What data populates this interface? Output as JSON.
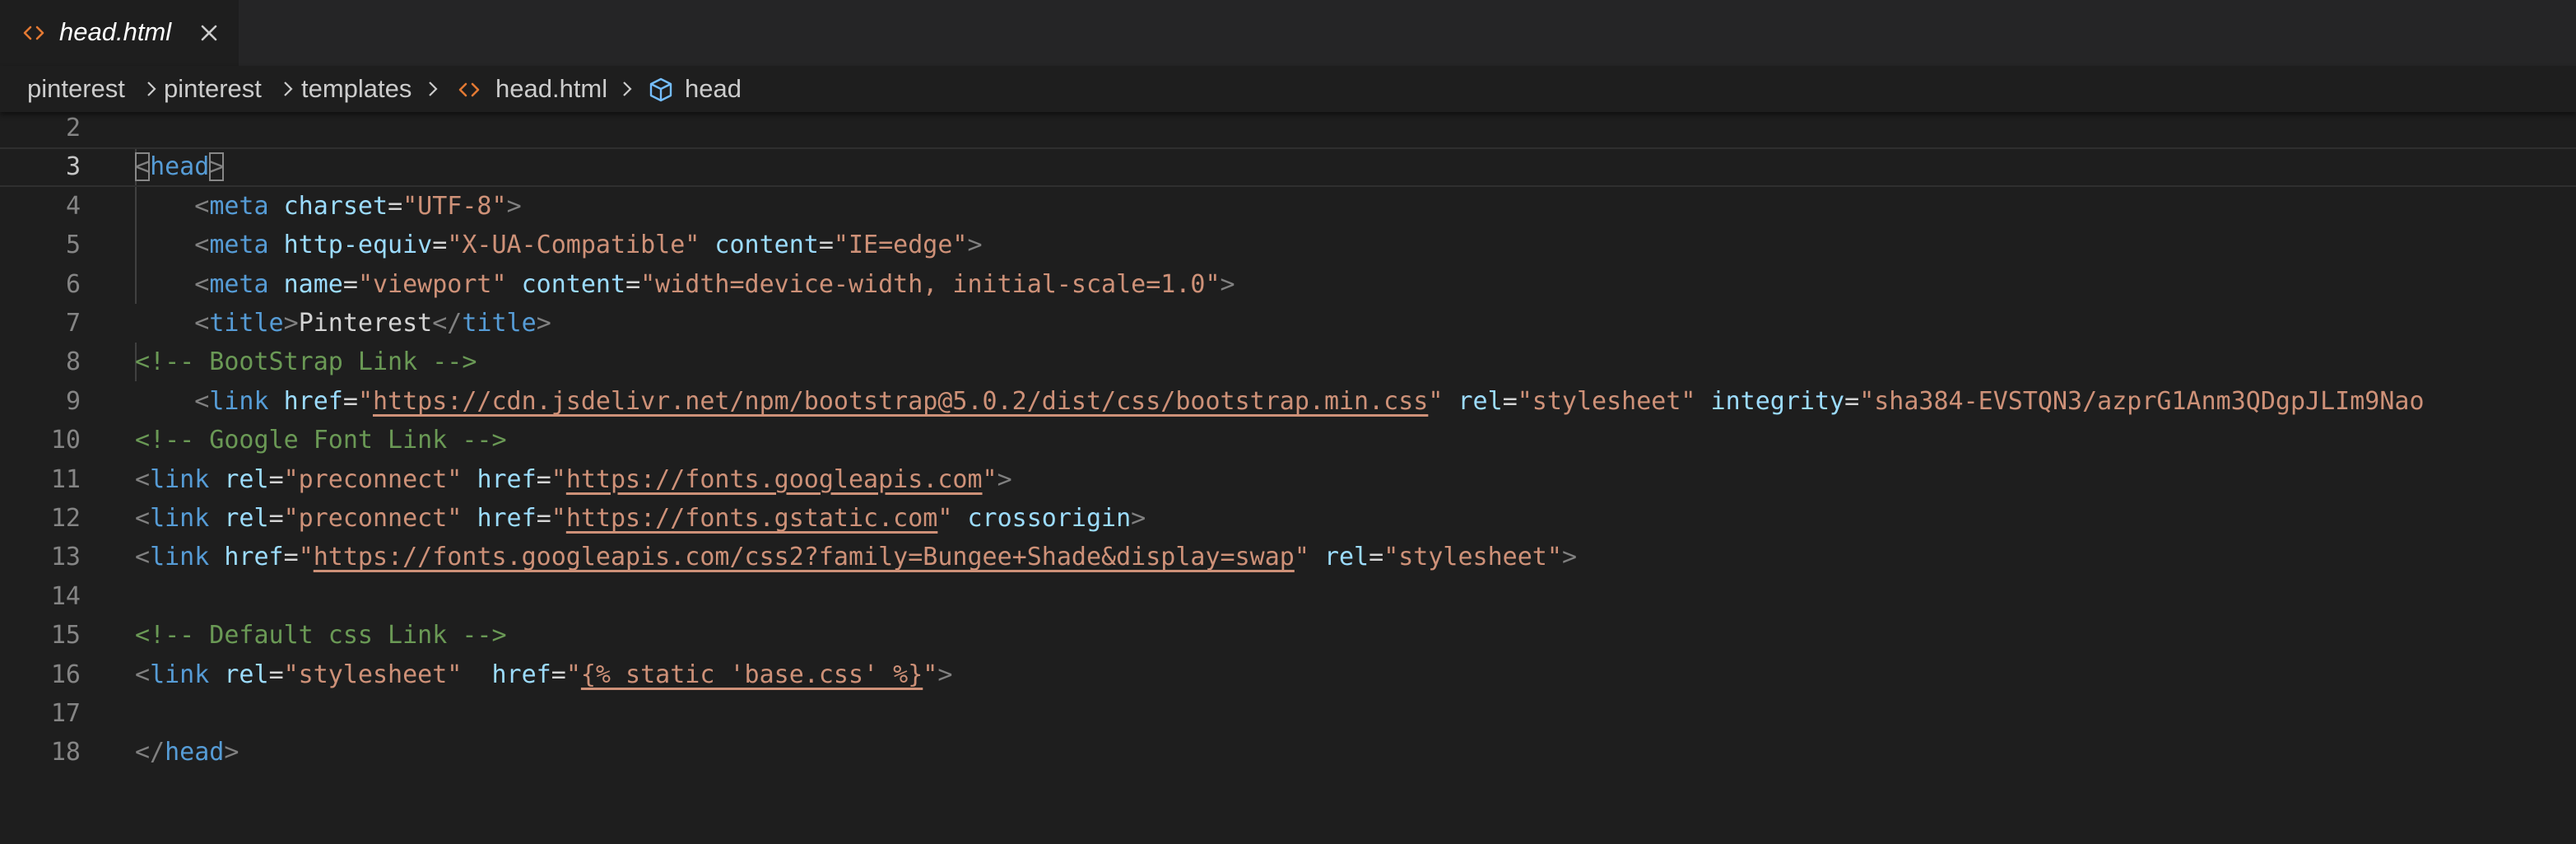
{
  "tab": {
    "title": "head.html",
    "icon": "code-file-icon",
    "close_icon": "close-icon"
  },
  "breadcrumb": {
    "items": [
      "pinterest",
      "pinterest",
      "templates",
      "head.html",
      "head"
    ]
  },
  "editor": {
    "current_line": 3,
    "lines": [
      {
        "n": "2",
        "tokens": []
      },
      {
        "n": "3",
        "tokens": [
          {
            "t": "<",
            "c": "br"
          },
          {
            "t": "head",
            "c": "tag"
          },
          {
            "t": ">",
            "c": "br"
          }
        ]
      },
      {
        "n": "4",
        "tokens": [
          {
            "t": "    ",
            "c": "txt"
          },
          {
            "t": "<",
            "c": "br"
          },
          {
            "t": "meta",
            "c": "tag"
          },
          {
            "t": " ",
            "c": "txt"
          },
          {
            "t": "charset",
            "c": "attr"
          },
          {
            "t": "=",
            "c": "txt"
          },
          {
            "t": "\"UTF-8\"",
            "c": "str"
          },
          {
            "t": ">",
            "c": "br"
          }
        ]
      },
      {
        "n": "5",
        "tokens": [
          {
            "t": "    ",
            "c": "txt"
          },
          {
            "t": "<",
            "c": "br"
          },
          {
            "t": "meta",
            "c": "tag"
          },
          {
            "t": " ",
            "c": "txt"
          },
          {
            "t": "http-equiv",
            "c": "attr"
          },
          {
            "t": "=",
            "c": "txt"
          },
          {
            "t": "\"X-UA-Compatible\"",
            "c": "str"
          },
          {
            "t": " ",
            "c": "txt"
          },
          {
            "t": "content",
            "c": "attr"
          },
          {
            "t": "=",
            "c": "txt"
          },
          {
            "t": "\"IE=edge\"",
            "c": "str"
          },
          {
            "t": ">",
            "c": "br"
          }
        ]
      },
      {
        "n": "6",
        "tokens": [
          {
            "t": "    ",
            "c": "txt"
          },
          {
            "t": "<",
            "c": "br"
          },
          {
            "t": "meta",
            "c": "tag"
          },
          {
            "t": " ",
            "c": "txt"
          },
          {
            "t": "name",
            "c": "attr"
          },
          {
            "t": "=",
            "c": "txt"
          },
          {
            "t": "\"viewport\"",
            "c": "str"
          },
          {
            "t": " ",
            "c": "txt"
          },
          {
            "t": "content",
            "c": "attr"
          },
          {
            "t": "=",
            "c": "txt"
          },
          {
            "t": "\"width=device-width, initial-scale=1.0\"",
            "c": "str"
          },
          {
            "t": ">",
            "c": "br"
          }
        ]
      },
      {
        "n": "7",
        "tokens": [
          {
            "t": "    ",
            "c": "txt"
          },
          {
            "t": "<",
            "c": "br"
          },
          {
            "t": "title",
            "c": "tag"
          },
          {
            "t": ">",
            "c": "br"
          },
          {
            "t": "Pinterest",
            "c": "txt"
          },
          {
            "t": "</",
            "c": "br"
          },
          {
            "t": "title",
            "c": "tag"
          },
          {
            "t": ">",
            "c": "br"
          }
        ]
      },
      {
        "n": "8",
        "tokens": [
          {
            "t": "<!-- BootStrap Link -->",
            "c": "com"
          }
        ]
      },
      {
        "n": "9",
        "tokens": [
          {
            "t": "    ",
            "c": "txt"
          },
          {
            "t": "<",
            "c": "br"
          },
          {
            "t": "link",
            "c": "tag"
          },
          {
            "t": " ",
            "c": "txt"
          },
          {
            "t": "href",
            "c": "attr"
          },
          {
            "t": "=",
            "c": "txt"
          },
          {
            "t": "\"",
            "c": "str"
          },
          {
            "t": "https://cdn.jsdelivr.net/npm/bootstrap@5.0.2/dist/css/bootstrap.min.css",
            "c": "str",
            "link": true
          },
          {
            "t": "\"",
            "c": "str"
          },
          {
            "t": " ",
            "c": "txt"
          },
          {
            "t": "rel",
            "c": "attr"
          },
          {
            "t": "=",
            "c": "txt"
          },
          {
            "t": "\"stylesheet\"",
            "c": "str"
          },
          {
            "t": " ",
            "c": "txt"
          },
          {
            "t": "integrity",
            "c": "attr"
          },
          {
            "t": "=",
            "c": "txt"
          },
          {
            "t": "\"sha384-EVSTQN3/azprG1Anm3QDgpJLIm9Nao",
            "c": "str"
          }
        ]
      },
      {
        "n": "10",
        "tokens": [
          {
            "t": "<!-- Google Font Link -->",
            "c": "com"
          }
        ]
      },
      {
        "n": "11",
        "tokens": [
          {
            "t": "<",
            "c": "br"
          },
          {
            "t": "link",
            "c": "tag"
          },
          {
            "t": " ",
            "c": "txt"
          },
          {
            "t": "rel",
            "c": "attr"
          },
          {
            "t": "=",
            "c": "txt"
          },
          {
            "t": "\"preconnect\"",
            "c": "str"
          },
          {
            "t": " ",
            "c": "txt"
          },
          {
            "t": "href",
            "c": "attr"
          },
          {
            "t": "=",
            "c": "txt"
          },
          {
            "t": "\"",
            "c": "str"
          },
          {
            "t": "https://fonts.googleapis.com",
            "c": "str",
            "link": true
          },
          {
            "t": "\"",
            "c": "str"
          },
          {
            "t": ">",
            "c": "br"
          }
        ]
      },
      {
        "n": "12",
        "tokens": [
          {
            "t": "<",
            "c": "br"
          },
          {
            "t": "link",
            "c": "tag"
          },
          {
            "t": " ",
            "c": "txt"
          },
          {
            "t": "rel",
            "c": "attr"
          },
          {
            "t": "=",
            "c": "txt"
          },
          {
            "t": "\"preconnect\"",
            "c": "str"
          },
          {
            "t": " ",
            "c": "txt"
          },
          {
            "t": "href",
            "c": "attr"
          },
          {
            "t": "=",
            "c": "txt"
          },
          {
            "t": "\"",
            "c": "str"
          },
          {
            "t": "https://fonts.gstatic.com",
            "c": "str",
            "link": true
          },
          {
            "t": "\"",
            "c": "str"
          },
          {
            "t": " ",
            "c": "txt"
          },
          {
            "t": "crossorigin",
            "c": "attr"
          },
          {
            "t": ">",
            "c": "br"
          }
        ]
      },
      {
        "n": "13",
        "tokens": [
          {
            "t": "<",
            "c": "br"
          },
          {
            "t": "link",
            "c": "tag"
          },
          {
            "t": " ",
            "c": "txt"
          },
          {
            "t": "href",
            "c": "attr"
          },
          {
            "t": "=",
            "c": "txt"
          },
          {
            "t": "\"",
            "c": "str"
          },
          {
            "t": "https://fonts.googleapis.com/css2?family=Bungee+Shade&display=swap",
            "c": "str",
            "link": true
          },
          {
            "t": "\"",
            "c": "str"
          },
          {
            "t": " ",
            "c": "txt"
          },
          {
            "t": "rel",
            "c": "attr"
          },
          {
            "t": "=",
            "c": "txt"
          },
          {
            "t": "\"stylesheet\"",
            "c": "str"
          },
          {
            "t": ">",
            "c": "br"
          }
        ]
      },
      {
        "n": "14",
        "tokens": []
      },
      {
        "n": "15",
        "tokens": [
          {
            "t": "<!-- Default css Link -->",
            "c": "com"
          }
        ]
      },
      {
        "n": "16",
        "tokens": [
          {
            "t": "<",
            "c": "br"
          },
          {
            "t": "link",
            "c": "tag"
          },
          {
            "t": " ",
            "c": "txt"
          },
          {
            "t": "rel",
            "c": "attr"
          },
          {
            "t": "=",
            "c": "txt"
          },
          {
            "t": "\"stylesheet\"",
            "c": "str"
          },
          {
            "t": "  ",
            "c": "txt"
          },
          {
            "t": "href",
            "c": "attr"
          },
          {
            "t": "=",
            "c": "txt"
          },
          {
            "t": "\"",
            "c": "str"
          },
          {
            "t": "{% static 'base.css' %}",
            "c": "str",
            "link": true
          },
          {
            "t": "\"",
            "c": "str"
          },
          {
            "t": ">",
            "c": "br"
          }
        ]
      },
      {
        "n": "17",
        "tokens": []
      },
      {
        "n": "18",
        "tokens": [
          {
            "t": "</",
            "c": "br"
          },
          {
            "t": "head",
            "c": "tag"
          },
          {
            "t": ">",
            "c": "br"
          }
        ]
      }
    ]
  },
  "colors": {
    "tag": "#569cd6",
    "attribute": "#9cdcfe",
    "string": "#ce9178",
    "comment": "#6a9955",
    "punctuation": "#808080",
    "line_number": "#858585",
    "icon_orange": "#e37933",
    "icon_blue": "#75beff"
  }
}
